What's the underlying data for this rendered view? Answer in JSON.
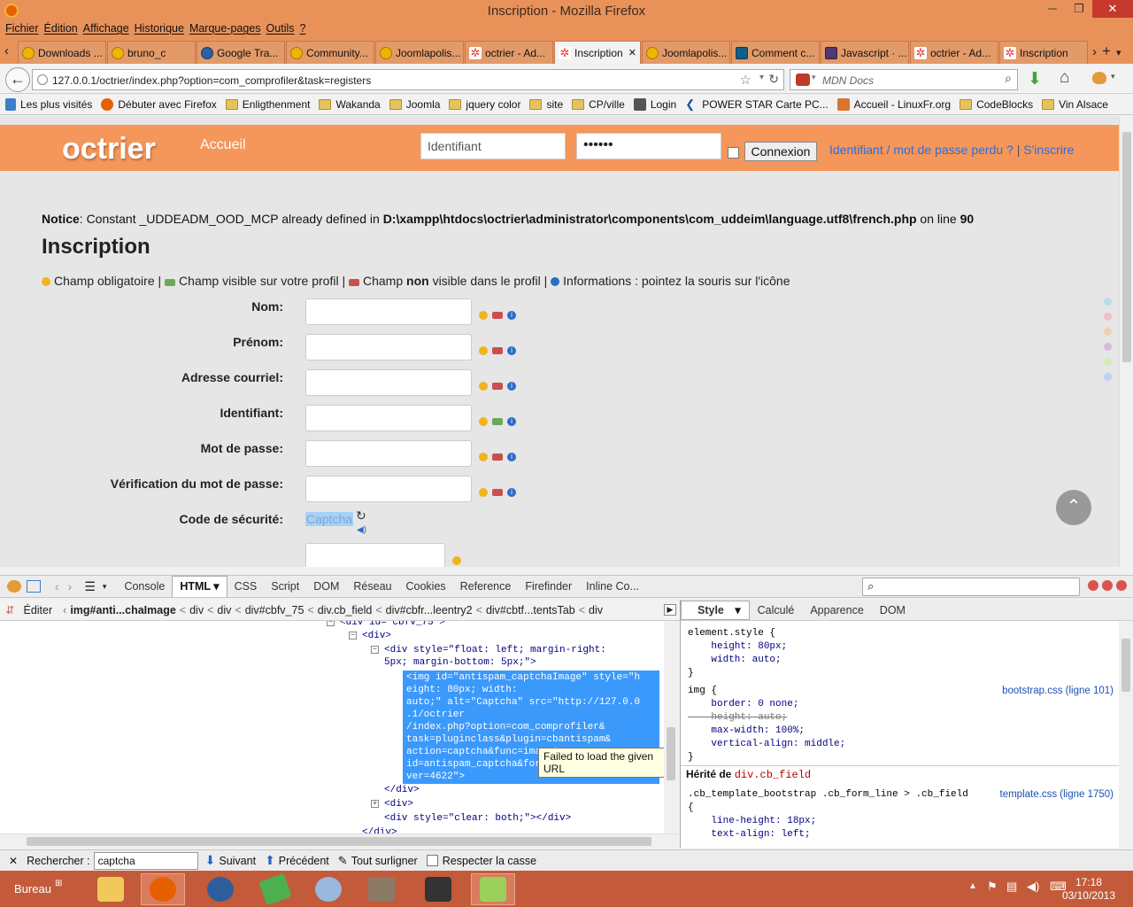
{
  "window": {
    "title": "Inscription - Mozilla Firefox",
    "minimize": "─",
    "maximize": "❐",
    "close": "✕"
  },
  "menu": [
    "Fichier",
    "Édition",
    "Affichage",
    "Historique",
    "Marque-pages",
    "Outils",
    "?"
  ],
  "tabs": [
    {
      "label": "Downloads ...",
      "icon": "joomlapolis-icon"
    },
    {
      "label": "bruno_c",
      "icon": "joomlapolis-icon"
    },
    {
      "label": "Google Tra...",
      "icon": "google-icon"
    },
    {
      "label": "Community...",
      "icon": "joomlapolis-icon"
    },
    {
      "label": "Joomlapolis...",
      "icon": "joomlapolis-icon"
    },
    {
      "label": "octrier - Ad...",
      "icon": "joomla-icon"
    },
    {
      "label": "Inscription",
      "icon": "joomla-icon",
      "close": "✕"
    },
    {
      "label": "Joomlapolis...",
      "icon": "joomlapolis-icon"
    },
    {
      "label": "Comment c...",
      "icon": "k-icon"
    },
    {
      "label": "Javascript · ...",
      "icon": "bootstrap-icon"
    },
    {
      "label": "octrier - Ad...",
      "icon": "joomla-icon"
    },
    {
      "label": "Inscription",
      "icon": "joomla-icon"
    }
  ],
  "nav": {
    "url": "127.0.0.1/octrier/index.php?option=com_comprofiler&task=registers",
    "search_placeholder": "MDN Docs"
  },
  "bookmarks": [
    "Les plus visités",
    "Débuter avec Firefox",
    "Enligthenment",
    "Wakanda",
    "Joomla",
    "jquery color",
    "site",
    "CP/ville",
    "Login",
    "POWER STAR Carte PC...",
    "Accueil - LinuxFr.org",
    "CodeBlocks",
    "Vin Alsace"
  ],
  "site": {
    "logo": "octrier",
    "nav_home": "Accueil",
    "login_user": "Identifiant",
    "login_pass": "••••••",
    "connect": "Connexion",
    "lost": "Identifiant / mot de passe perdu ?",
    "sep": "|",
    "register": "S'inscrire"
  },
  "notice": {
    "label": "Notice",
    "text": ": Constant _UDDEADM_OOD_MCP already defined in ",
    "path": "D:\\xampp\\htdocs\\octrier\\administrator\\components\\com_uddeim\\language.utf8\\french.php",
    "online": " on line ",
    "line": "90"
  },
  "page_title": "Inscription",
  "legend": {
    "required": "Champ obligatoire |",
    "visible": "Champ visible sur votre profil |",
    "notvisible_pre": "Champ",
    "notvisible_bold": "non",
    "notvisible_post": "visible dans le profil |",
    "info": "Informations : pointez la souris sur l'icône"
  },
  "fields": [
    "Nom:",
    "Prénom:",
    "Adresse courriel:",
    "Identifiant:",
    "Mot de passe:",
    "Vérification du mot de passe:"
  ],
  "captcha": {
    "label": "Code de sécurité:",
    "alt": "Captcha"
  },
  "firebug": {
    "tabs": [
      "Console",
      "HTML",
      "CSS",
      "Script",
      "DOM",
      "Réseau",
      "Cookies",
      "Reference",
      "Firefinder",
      "Inline Co..."
    ],
    "crumbs": [
      "img#anti...chaImage",
      "div",
      "div",
      "div#cbfv_75",
      "div.cb_field",
      "div#cbfr...leentry2",
      "div#cbtf...tentsTab",
      "div"
    ],
    "edit": "Éditer",
    "side_tabs": [
      "Style",
      "Calculé",
      "Apparence",
      "DOM"
    ],
    "tooltip": "Failed to load the given URL",
    "html": {
      "l0": "<div id=\"cbfv_75\">",
      "l1": "<div>",
      "l2a": "<div style=\"float: left; margin-right:",
      "l2b": "5px; margin-bottom: 5px;\">",
      "sel": "<img id=\"antispam_captchaImage\" style=\"h\neight: 80px; width:\nauto;\" alt=\"Captcha\" src=\"http://127.0.0\n.1/octrier\n/index.php?option=com_comprofiler&\ntask=pluginclass&plugin=cbantispam&\naction=captcha&func=image&\nid=antispam_captcha&format=raw&\nver=4622\">",
      "l3": "</div>",
      "l4": "<div>",
      "l5": "<div style=\"clear: both;\"></div>",
      "l6": "</div>"
    },
    "css": {
      "r1": "element.style {",
      "r1a": "    height: 80px;",
      "r1b": "    width: auto;",
      "close": "}",
      "r2": "img {",
      "r2src": "bootstrap.css (ligne 101)",
      "r2a": "    border: 0 none;",
      "r2b": "    height: auto;",
      "r2c": "    max-width: 100%;",
      "r2d": "    vertical-align: middle;",
      "inh_label": "Hérité de",
      "inh_sel": "div.cb_field",
      "r3": ".cb_template_bootstrap .cb_form_line > .cb_field",
      "r3src": "template.css (ligne 1750)",
      "r3open": "{",
      "r3a": "    line-height: 18px;",
      "r3b": "    text-align: left;"
    }
  },
  "find": {
    "label": "Rechercher :",
    "value": "captcha",
    "next": "Suivant",
    "prev": "Précédent",
    "all": "Tout surligner",
    "case": "Respecter la casse"
  },
  "taskbar": {
    "bureau": "Bureau",
    "time": "17:18",
    "date": "03/10/2013"
  },
  "colors": {
    "accent": "#f5965a",
    "link": "#2d6fd5",
    "selection": "#3b99fc"
  }
}
